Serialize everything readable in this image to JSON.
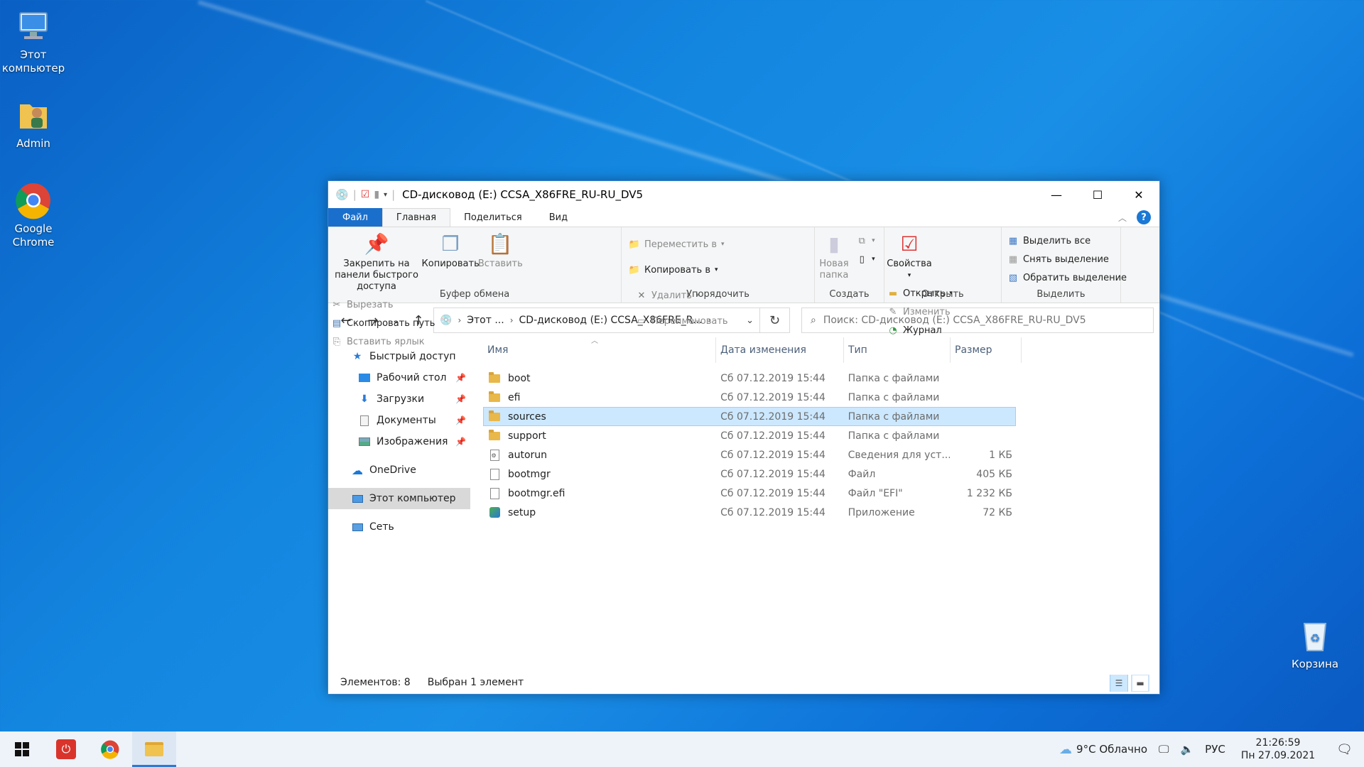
{
  "desktop": {
    "icons": [
      {
        "label": "Этот компьютер"
      },
      {
        "label": "Admin"
      },
      {
        "label": "Google Chrome"
      },
      {
        "label": "Корзина"
      }
    ]
  },
  "window": {
    "title": "CD-дисковод (E:) CCSA_X86FRE_RU-RU_DV5",
    "tabs": [
      "Файл",
      "Главная",
      "Поделиться",
      "Вид"
    ],
    "ribbon": {
      "clipboard": {
        "label": "Буфер обмена",
        "pin": "Закрепить на панели быстрого доступа",
        "copy": "Копировать",
        "paste": "Вставить",
        "cut": "Вырезать",
        "copy_path": "Скопировать путь",
        "paste_shortcut": "Вставить ярлык"
      },
      "organize": {
        "label": "Упорядочить",
        "move_to": "Переместить в",
        "copy_to": "Копировать в",
        "delete": "Удалить",
        "rename": "Переименовать"
      },
      "create": {
        "label": "Создать",
        "new_folder": "Новая папка"
      },
      "open": {
        "label": "Открыть",
        "properties": "Свойства",
        "open": "Открыть",
        "edit": "Изменить",
        "history": "Журнал"
      },
      "select": {
        "label": "Выделить",
        "select_all": "Выделить все",
        "select_none": "Снять выделение",
        "invert": "Обратить выделение"
      }
    },
    "address": {
      "crumbs": [
        "Этот ...",
        "CD-дисковод (E:) CCSA_X86FRE_R..."
      ]
    },
    "search": {
      "placeholder": "Поиск: CD-дисковод (E:) CCSA_X86FRE_RU-RU_DV5"
    },
    "nav": {
      "quick_access": "Быстрый доступ",
      "desktop": "Рабочий стол",
      "downloads": "Загрузки",
      "documents": "Документы",
      "pictures": "Изображения",
      "onedrive": "OneDrive",
      "this_pc": "Этот компьютер",
      "network": "Сеть"
    },
    "columns": {
      "name": "Имя",
      "date": "Дата изменения",
      "type": "Тип",
      "size": "Размер"
    },
    "files": [
      {
        "name": "boot",
        "date": "Сб 07.12.2019 15:44",
        "type": "Папка с файлами",
        "size": ""
      },
      {
        "name": "efi",
        "date": "Сб 07.12.2019 15:44",
        "type": "Папка с файлами",
        "size": ""
      },
      {
        "name": "sources",
        "date": "Сб 07.12.2019 15:44",
        "type": "Папка с файлами",
        "size": ""
      },
      {
        "name": "support",
        "date": "Сб 07.12.2019 15:44",
        "type": "Папка с файлами",
        "size": ""
      },
      {
        "name": "autorun",
        "date": "Сб 07.12.2019 15:44",
        "type": "Сведения для уст...",
        "size": "1 КБ"
      },
      {
        "name": "bootmgr",
        "date": "Сб 07.12.2019 15:44",
        "type": "Файл",
        "size": "405 КБ"
      },
      {
        "name": "bootmgr.efi",
        "date": "Сб 07.12.2019 15:44",
        "type": "Файл \"EFI\"",
        "size": "1 232 КБ"
      },
      {
        "name": "setup",
        "date": "Сб 07.12.2019 15:44",
        "type": "Приложение",
        "size": "72 КБ"
      }
    ],
    "status": {
      "count": "Элементов: 8",
      "selected": "Выбран 1 элемент"
    }
  },
  "taskbar": {
    "weather": "9°C  Облачно",
    "lang": "РУС",
    "time": "21:26:59",
    "date": "Пн 27.09.2021"
  },
  "colors": {
    "accent": "#1a6fcc",
    "selection": "#cce8ff"
  }
}
